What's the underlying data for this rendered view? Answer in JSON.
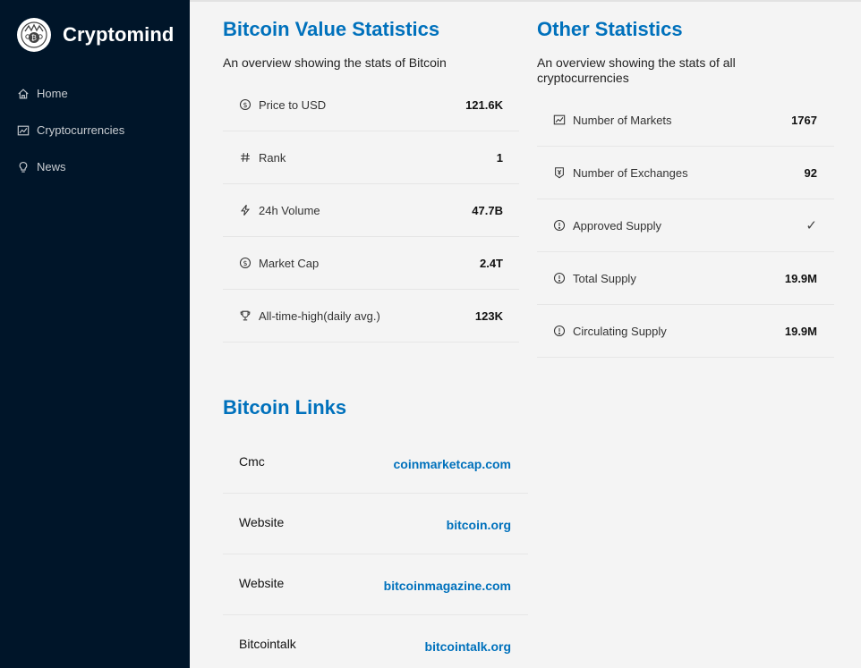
{
  "app": {
    "name": "Cryptomind"
  },
  "nav": {
    "items": [
      {
        "label": "Home",
        "icon": "home-icon"
      },
      {
        "label": "Cryptocurrencies",
        "icon": "chart-icon"
      },
      {
        "label": "News",
        "icon": "bulb-icon"
      }
    ]
  },
  "value_stats": {
    "title": "Bitcoin Value Statistics",
    "subtitle": "An overview showing the stats of Bitcoin",
    "rows": [
      {
        "label": "Price to USD",
        "value": "121.6K",
        "icon": "dollar-circle-icon"
      },
      {
        "label": "Rank",
        "value": "1",
        "icon": "number-icon"
      },
      {
        "label": "24h Volume",
        "value": "47.7B",
        "icon": "thunderbolt-icon"
      },
      {
        "label": "Market Cap",
        "value": "2.4T",
        "icon": "dollar-circle-icon"
      },
      {
        "label": "All-time-high(daily avg.)",
        "value": "123K",
        "icon": "trophy-icon"
      }
    ]
  },
  "other_stats": {
    "title": "Other Statistics",
    "subtitle": "An overview showing the stats of all cryptocurrencies",
    "rows": [
      {
        "label": "Number of Markets",
        "value": "1767",
        "icon": "fund-icon"
      },
      {
        "label": "Number of Exchanges",
        "value": "92",
        "icon": "money-collect-icon"
      },
      {
        "label": "Approved Supply",
        "value": "✓",
        "icon": "exclamation-circle-icon"
      },
      {
        "label": "Total Supply",
        "value": "19.9M",
        "icon": "exclamation-circle-icon"
      },
      {
        "label": "Circulating Supply",
        "value": "19.9M",
        "icon": "exclamation-circle-icon"
      }
    ]
  },
  "links": {
    "title": "Bitcoin Links",
    "items": [
      {
        "name": "Cmc",
        "url": "coinmarketcap.com"
      },
      {
        "name": "Website",
        "url": "bitcoin.org"
      },
      {
        "name": "Website",
        "url": "bitcoinmagazine.com"
      },
      {
        "name": "Bitcointalk",
        "url": "bitcointalk.org"
      }
    ]
  }
}
